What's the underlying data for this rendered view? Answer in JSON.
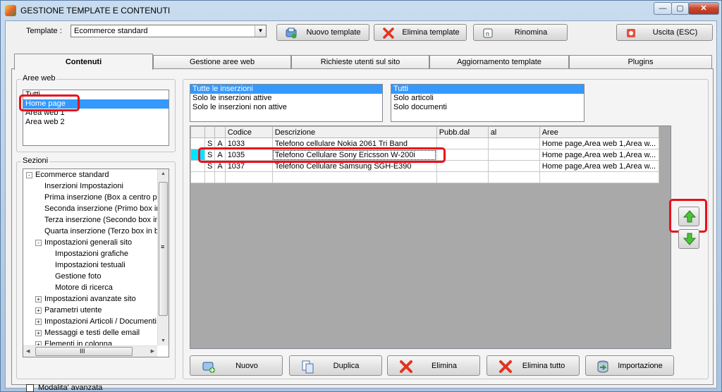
{
  "window": {
    "title": "GESTIONE TEMPLATE E CONTENUTI",
    "min_label": "—",
    "max_label": "▢",
    "close_label": "✕"
  },
  "toolbar": {
    "template_label": "Template :",
    "template_value": "Ecommerce standard",
    "new_template": "Nuovo template",
    "delete_template": "Elimina template",
    "rename": "Rinomina",
    "exit": "Uscita (ESC)"
  },
  "tabs": [
    "Contenuti",
    "Gestione aree web",
    "Richieste utenti sul sito",
    "Aggiornamento template",
    "Plugins"
  ],
  "aree_web": {
    "label": "Aree web",
    "items": [
      "Tutti",
      "Home page",
      "Area web 1",
      "Area web 2"
    ],
    "selected": 1
  },
  "sezioni": {
    "label": "Sezioni",
    "items": [
      {
        "text": "Ecommerce standard",
        "toggle": "-"
      },
      {
        "text": "Inserzioni Impostazioni",
        "toggle": ""
      },
      {
        "text": "Prima inserzione (Box a centro pa",
        "toggle": ""
      },
      {
        "text": "Seconda inserzione (Primo box in",
        "toggle": ""
      },
      {
        "text": "Terza inserzione (Secondo box in",
        "toggle": ""
      },
      {
        "text": "Quarta inserzione (Terzo box in b",
        "toggle": ""
      },
      {
        "text": "Impostazioni generali sito",
        "toggle": "-"
      },
      {
        "text": "Impostazioni grafiche",
        "toggle": ""
      },
      {
        "text": "Impostazioni testuali",
        "toggle": ""
      },
      {
        "text": "Gestione foto",
        "toggle": ""
      },
      {
        "text": "Motore di ricerca",
        "toggle": ""
      },
      {
        "text": "Impostazioni avanzate sito",
        "toggle": "+"
      },
      {
        "text": "Parametri utente",
        "toggle": "+"
      },
      {
        "text": "Impostazioni Articoli / Documenti",
        "toggle": "+"
      },
      {
        "text": "Messaggi e testi delle email",
        "toggle": "+"
      },
      {
        "text": "Elementi in colonna",
        "toggle": "+"
      }
    ],
    "scroll_h_mark": "III",
    "scroll_v_mark": "≡"
  },
  "modalita": {
    "label": "Modalita' avanzata",
    "checked": false
  },
  "filter_status": {
    "items": [
      "Tutte le inserzioni",
      "Solo le inserzioni attive",
      "Solo le inserzioni non attive"
    ],
    "selected": 0
  },
  "filter_type": {
    "items": [
      "Tutti",
      "Solo articoli",
      "Solo documenti"
    ],
    "selected": 0
  },
  "grid": {
    "columns": [
      "",
      "",
      "",
      "Codice",
      "Descrizione",
      "Pubb.dal",
      "al",
      "Aree"
    ],
    "rows": [
      {
        "s": "S",
        "a": "A",
        "codice": "1033",
        "descrizione": "Telefono cellulare Nokia 2061 Tri Band",
        "dal": "",
        "al": "",
        "aree": "Home page,Area web 1,Area w..."
      },
      {
        "s": "S",
        "a": "A",
        "codice": "1035",
        "descrizione": "Telefono Cellulare Sony Ericsson W-200i",
        "dal": "",
        "al": "",
        "aree": "Home page,Area web 1,Area w..."
      },
      {
        "s": "S",
        "a": "A",
        "codice": "1037",
        "descrizione": "Telefono Cellulare Samsung SGH-E390",
        "dal": "",
        "al": "",
        "aree": "Home page,Area web 1,Area w..."
      }
    ],
    "current_row": 1
  },
  "bottom": {
    "new": "Nuovo",
    "duplicate": "Duplica",
    "delete": "Elimina",
    "delete_all": "Elimina tutto",
    "import": "Importazione"
  },
  "colors": {
    "accent": "#3399ff",
    "highlight": "#e8101a",
    "row_marker": "#00e5ff"
  }
}
